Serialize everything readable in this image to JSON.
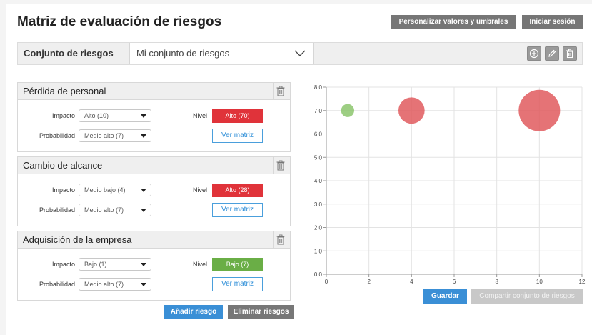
{
  "header": {
    "title": "Matriz de evaluación de riesgos",
    "customize_label": "Personalizar valores y umbrales",
    "login_label": "Iniciar sesión"
  },
  "risk_set": {
    "label": "Conjunto de riesgos",
    "selected": "Mi conjunto de riesgos",
    "icons": [
      "plus-circle-icon",
      "pencil-icon",
      "trash-icon"
    ]
  },
  "field_labels": {
    "impact": "Impacto",
    "probability": "Probabilidad",
    "level": "Nivel",
    "view_matrix": "Ver matriz"
  },
  "risks": [
    {
      "name": "Pérdida de personal",
      "impact": "Alto (10)",
      "probability": "Medio alto (7)",
      "level": "Alto (70)",
      "level_color": "#e0333a"
    },
    {
      "name": "Cambio de alcance",
      "impact": "Medio bajo (4)",
      "probability": "Medio alto (7)",
      "level": "Alto (28)",
      "level_color": "#e0333a"
    },
    {
      "name": "Adquisición de la empresa",
      "impact": "Bajo (1)",
      "probability": "Medio alto (7)",
      "level": "Bajo (7)",
      "level_color": "#6aae46"
    }
  ],
  "actions": {
    "add_risk": "Añadir riesgo",
    "delete_risks": "Eliminar riesgos",
    "save": "Guardar",
    "share": "Compartir conjunto de riesgos"
  },
  "chart_data": {
    "type": "scatter",
    "x_ticks": [
      "0",
      "2",
      "4",
      "6",
      "8",
      "10",
      "12"
    ],
    "y_ticks": [
      "0.0",
      "1.0",
      "2.0",
      "3.0",
      "4.0",
      "5.0",
      "6.0",
      "7.0",
      "8.0"
    ],
    "xlim": [
      0,
      12
    ],
    "ylim": [
      0,
      8
    ],
    "grid": true,
    "points": [
      {
        "x": 1,
        "y": 7,
        "size": 7,
        "color": "#8cc66d"
      },
      {
        "x": 4,
        "y": 7,
        "size": 28,
        "color": "#e05a5e"
      },
      {
        "x": 10,
        "y": 7,
        "size": 70,
        "color": "#e05a5e"
      }
    ]
  },
  "colors": {
    "accent": "#3a8fd6",
    "high": "#e0333a",
    "low": "#6aae46"
  }
}
